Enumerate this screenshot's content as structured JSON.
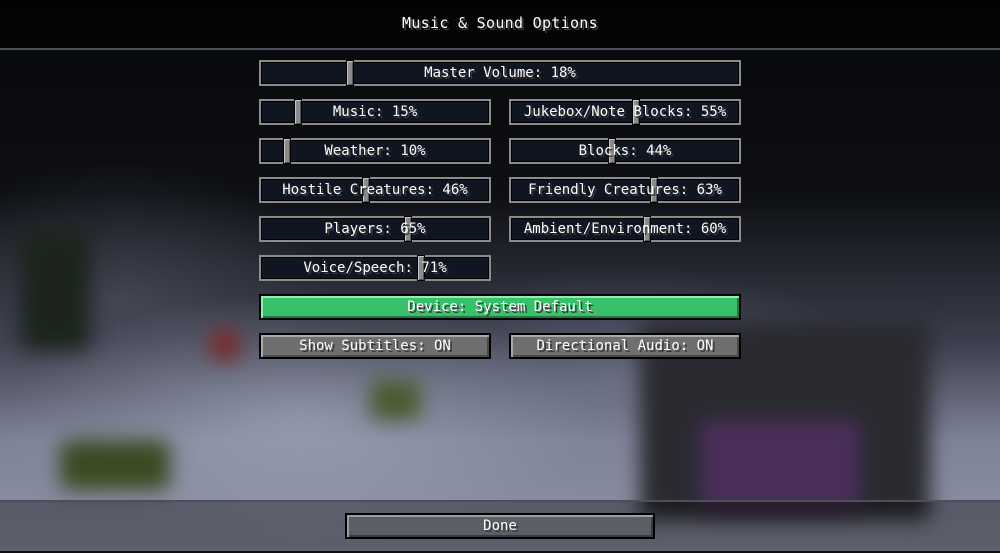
{
  "screen": {
    "title": "Music & Sound Options",
    "done_label": "Done"
  },
  "sliders": {
    "master": {
      "label": "Master Volume: 18%",
      "value": 0.18
    },
    "music": {
      "label": "Music: 15%",
      "value": 0.15
    },
    "jukebox": {
      "label": "Jukebox/Note Blocks: 55%",
      "value": 0.55
    },
    "weather": {
      "label": "Weather: 10%",
      "value": 0.1
    },
    "blocks": {
      "label": "Blocks: 44%",
      "value": 0.44
    },
    "hostile": {
      "label": "Hostile Creatures: 46%",
      "value": 0.46
    },
    "friendly": {
      "label": "Friendly Creatures: 63%",
      "value": 0.63
    },
    "players": {
      "label": "Players: 65%",
      "value": 0.65
    },
    "ambient": {
      "label": "Ambient/Environment: 60%",
      "value": 0.6
    },
    "voice": {
      "label": "Voice/Speech: 71%",
      "value": 0.71
    }
  },
  "buttons": {
    "device": "Device: System Default",
    "subtitles": "Show Subtitles: ON",
    "directional": "Directional Audio: ON"
  },
  "colors": {
    "accent_green": "#38c16a",
    "slider_track": "#0f1622",
    "button_gray": "#6f6f6f"
  }
}
